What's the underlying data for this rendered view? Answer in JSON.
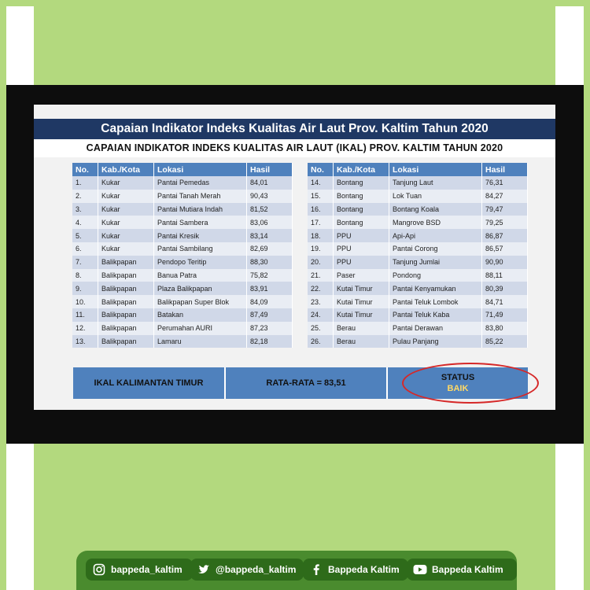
{
  "slide": {
    "title": "Capaian Indikator Indeks Kualitas Air Laut Prov. Kaltim Tahun 2020",
    "subtitle": "CAPAIAN INDIKATOR INDEKS KUALITAS AIR LAUT (IKAL) PROV. KALTIM TAHUN 2020"
  },
  "table": {
    "headers": [
      "No.",
      "Kab./Kota",
      "Lokasi",
      "Hasil"
    ],
    "left_rows": [
      [
        "1.",
        "Kukar",
        "Pantai Pemedas",
        "84,01"
      ],
      [
        "2.",
        "Kukar",
        "Pantai Tanah Merah",
        "90,43"
      ],
      [
        "3.",
        "Kukar",
        "Pantai Mutiara Indah",
        "81,52"
      ],
      [
        "4.",
        "Kukar",
        "Pantai Sambera",
        "83,06"
      ],
      [
        "5.",
        "Kukar",
        "Pantai Kresik",
        "83,14"
      ],
      [
        "6.",
        "Kukar",
        "Pantai Sambilang",
        "82,69"
      ],
      [
        "7.",
        "Balikpapan",
        "Pendopo Teritip",
        "88,30"
      ],
      [
        "8.",
        "Balikpapan",
        "Banua Patra",
        "75,82"
      ],
      [
        "9.",
        "Balikpapan",
        "Plaza Balikpapan",
        "83,91"
      ],
      [
        "10.",
        "Balikpapan",
        "Balikpapan Super Blok",
        "84,09"
      ],
      [
        "11.",
        "Balikpapan",
        "Batakan",
        "87,49"
      ],
      [
        "12.",
        "Balikpapan",
        "Perumahan AURI",
        "87,23"
      ],
      [
        "13.",
        "Balikpapan",
        "Lamaru",
        "82,18"
      ]
    ],
    "right_rows": [
      [
        "14.",
        "Bontang",
        "Tanjung Laut",
        "76,31"
      ],
      [
        "15.",
        "Bontang",
        "Lok Tuan",
        "84,27"
      ],
      [
        "16.",
        "Bontang",
        "Bontang Koala",
        "79,47"
      ],
      [
        "17.",
        "Bontang",
        "Mangrove BSD",
        "79,25"
      ],
      [
        "18.",
        "PPU",
        "Api-Api",
        "86,87"
      ],
      [
        "19.",
        "PPU",
        "Pantai Corong",
        "86,57"
      ],
      [
        "20.",
        "PPU",
        "Tanjung Jumlai",
        "90,90"
      ],
      [
        "21.",
        "Paser",
        "Pondong",
        "88,11"
      ],
      [
        "22.",
        "Kutai Timur",
        "Pantai Kenyamukan",
        "80,39"
      ],
      [
        "23.",
        "Kutai Timur",
        "Pantai Teluk Lombok",
        "84,71"
      ],
      [
        "24.",
        "Kutai Timur",
        "Pantai Teluk Kaba",
        "71,49"
      ],
      [
        "25.",
        "Berau",
        "Pantai Derawan",
        "83,80"
      ],
      [
        "26.",
        "Berau",
        "Pulau Panjang",
        "85,22"
      ]
    ]
  },
  "summary": {
    "region": "IKAL KALIMANTAN TIMUR",
    "average": "RATA-RATA = 83,51",
    "status_label": "STATUS",
    "status_value": "BAIK"
  },
  "social": {
    "instagram": "bappeda_kaltim",
    "twitter": "@bappeda_kaltim",
    "facebook": "Bappeda Kaltim",
    "youtube": "Bappeda Kaltim"
  },
  "colors": {
    "green_bg": "#b3d97e",
    "header_blue": "#1f3864",
    "table_header": "#4f81bd",
    "status_circle": "#d62828",
    "status_value": "#ffd966",
    "social_bar": "#4a8b2e"
  }
}
